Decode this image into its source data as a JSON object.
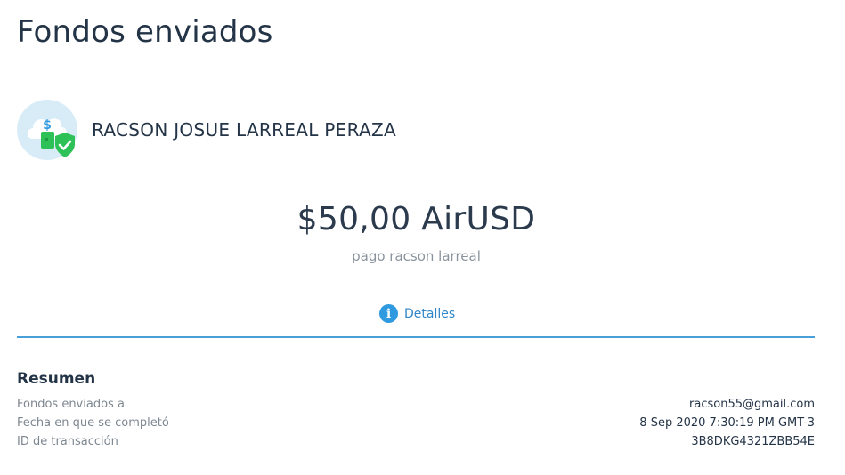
{
  "page": {
    "title": "Fondos enviados"
  },
  "recipient": {
    "name": "RACSON JOSUE LARREAL PERAZA",
    "avatar_icon": "cloud-money-shield-icon"
  },
  "transfer": {
    "amount": "$50,00 AirUSD",
    "memo": "pago racson larreal"
  },
  "details": {
    "label": "Detalles",
    "icon": "info-icon",
    "icon_glyph": "i"
  },
  "summary": {
    "title": "Resumen",
    "rows": [
      {
        "label": "Fondos enviados a",
        "value": "racson55@gmail.com"
      },
      {
        "label": "Fecha en que se completó",
        "value": "8 Sep 2020 7:30:19 PM GMT-3"
      },
      {
        "label": "ID de transacción",
        "value": "3B8DKG4321ZBB54E"
      }
    ]
  },
  "colors": {
    "accent": "#2f9ae0",
    "divider": "#4a9fd8",
    "text_primary": "#243447",
    "text_muted": "#8a939d",
    "shield_green": "#2ec157"
  }
}
